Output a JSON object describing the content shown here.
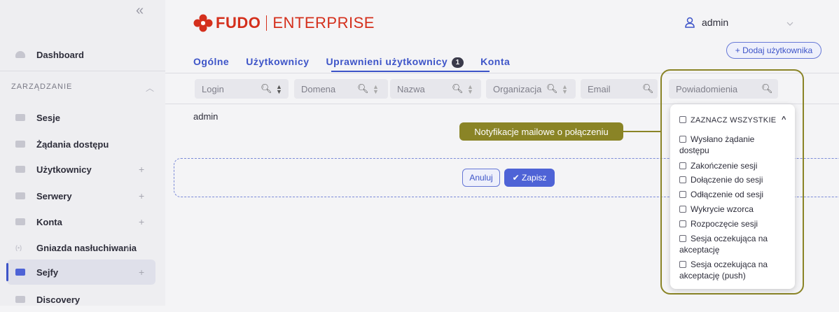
{
  "sidebar": {
    "collapse_glyph": "«",
    "dashboard": "Dashboard",
    "section": "ZARZĄDZANIE",
    "items": [
      {
        "label": "Sesje",
        "icon": "sessions-icon",
        "plus": ""
      },
      {
        "label": "Żądania dostępu",
        "icon": "access-requests-icon",
        "plus": ""
      },
      {
        "label": "Użytkownicy",
        "icon": "users-icon",
        "plus": "+"
      },
      {
        "label": "Serwery",
        "icon": "servers-icon",
        "plus": "+"
      },
      {
        "label": "Konta",
        "icon": "accounts-icon",
        "plus": "+"
      },
      {
        "label": "Gniazda nasłuchiwania",
        "icon": "listeners-icon",
        "plus": "+"
      },
      {
        "label": "Sejfy",
        "icon": "safes-icon",
        "plus": "+",
        "active": true
      },
      {
        "label": "Discovery",
        "icon": "discovery-icon",
        "plus": ""
      }
    ]
  },
  "header": {
    "brand": "FUDO",
    "product": "ENTERPRISE",
    "user": "admin",
    "add_user": "+ Dodaj użytkownika"
  },
  "tabs": [
    {
      "label": "Ogólne"
    },
    {
      "label": "Użytkownicy"
    },
    {
      "label": "Uprawnieni użytkownicy",
      "badge": "1",
      "active": true
    },
    {
      "label": "Konta"
    }
  ],
  "filters": {
    "login": "Login",
    "domain": "Domena",
    "name": "Nazwa",
    "org": "Organizacja",
    "email": "Email",
    "notifications": "Powiadomienia"
  },
  "rows": [
    {
      "login": "admin"
    }
  ],
  "actions": {
    "cancel": "Anuluj",
    "save": "✔ Zapisz"
  },
  "tooltip": "Notyfikacje mailowe o połączeniu",
  "dropdown": {
    "select_all": "ZAZNACZ WSZYSTKIE",
    "options": [
      {
        "line1": "Wysłano żądanie",
        "line2": "dostępu"
      },
      {
        "line1": "Zakończenie sesji"
      },
      {
        "line1": "Dołączenie do sesji"
      },
      {
        "line1": "Odłączenie od sesji"
      },
      {
        "line1": "Wykrycie wzorca"
      },
      {
        "line1": "Rozpoczęcie sesji"
      },
      {
        "line1": "Sesja oczekująca na",
        "line2": "akceptację"
      },
      {
        "line1": "Sesja oczekująca na",
        "line2": "akceptację (push)"
      }
    ]
  },
  "colors": {
    "brand": "#d42f1c",
    "accent": "#3d54c8",
    "highlight": "#8a8426"
  }
}
